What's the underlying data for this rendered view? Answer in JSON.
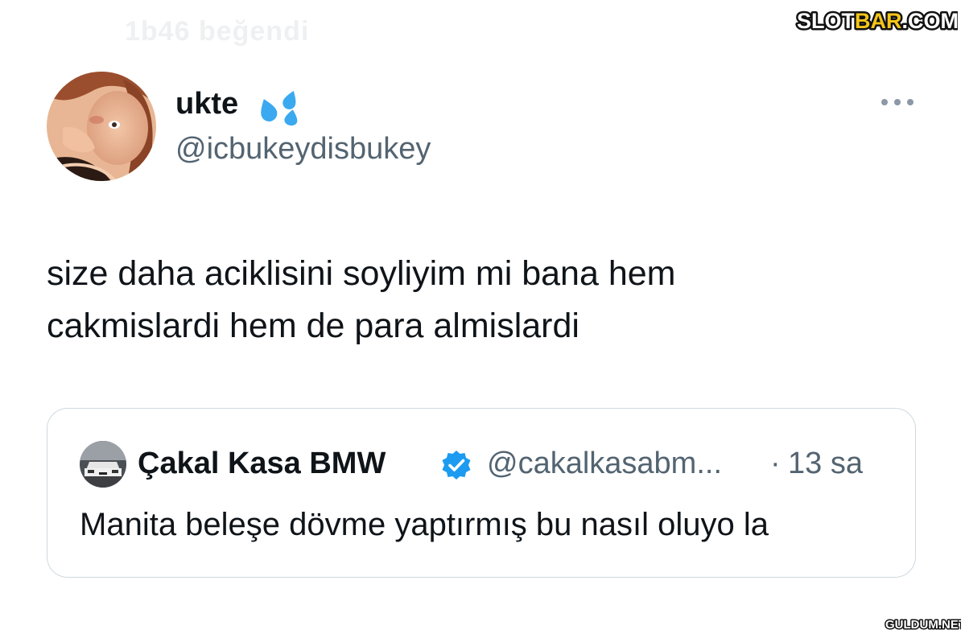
{
  "faded_header": "1b46 beğendi",
  "watermarks": {
    "top_prefix": "SLOT",
    "top_highlight": "BAR",
    "top_suffix": ".COM",
    "bottom": "GULDUM.NET"
  },
  "tweet": {
    "author": {
      "display_name": "ukte",
      "handle": "@icbukeydisbukey",
      "emoji_icon": "sweat-droplets-icon"
    },
    "text_lines": [
      "size daha aciklisini soyliyim mi bana hem",
      "cakmislardi hem de para almislardi"
    ],
    "more_icon": "more-dots-icon"
  },
  "quoted_tweet": {
    "author": {
      "display_name": "Çakal Kasa BMW",
      "handle": "@cakalkasabm...",
      "verified": true
    },
    "separator": "·",
    "time": "13 sa",
    "text": "Manita beleşe dövme yaptırmış bu nasıl oluyo la"
  },
  "colors": {
    "text_primary": "#0f1419",
    "text_secondary": "#536471",
    "verified_blue": "#1d9bf0",
    "border": "#cfd9de",
    "watermark_yellow": "#f5c518"
  }
}
